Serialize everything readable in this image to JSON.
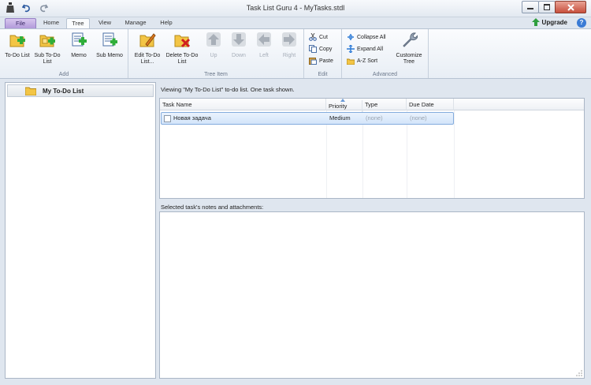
{
  "window": {
    "title": "Task List Guru 4 - MyTasks.stdl"
  },
  "tabs": [
    {
      "label": "File"
    },
    {
      "label": "Home"
    },
    {
      "label": "Tree"
    },
    {
      "label": "View"
    },
    {
      "label": "Manage"
    },
    {
      "label": "Help"
    }
  ],
  "upgrade_label": "Upgrade",
  "ribbon": {
    "add": {
      "label": "Add",
      "buttons": [
        {
          "label": "To-Do List"
        },
        {
          "label": "Sub To-Do List"
        },
        {
          "label": "Memo"
        },
        {
          "label": "Sub Memo"
        }
      ]
    },
    "tree_item": {
      "label": "Tree Item",
      "buttons": [
        {
          "label": "Edit To-Do List..."
        },
        {
          "label": "Delete To-Do List"
        },
        {
          "label": "Up"
        },
        {
          "label": "Down"
        },
        {
          "label": "Left"
        },
        {
          "label": "Right"
        }
      ]
    },
    "edit": {
      "label": "Edit",
      "buttons": [
        {
          "label": "Cut"
        },
        {
          "label": "Copy"
        },
        {
          "label": "Paste"
        }
      ]
    },
    "advanced": {
      "label": "Advanced",
      "buttons": [
        {
          "label": "Collapse All"
        },
        {
          "label": "Expand All"
        },
        {
          "label": "A-Z Sort"
        },
        {
          "label": "Customize Tree"
        }
      ]
    }
  },
  "tree": {
    "items": [
      {
        "label": "My To-Do List"
      }
    ]
  },
  "main": {
    "viewing_text": "Viewing \"My To-Do List\" to-do list. One task shown.",
    "columns": [
      "Task Name",
      "Priority",
      "Type",
      "Due Date"
    ],
    "rows": [
      {
        "name": "Новая задача",
        "priority": "Medium",
        "type": "(none)",
        "due": "(none)"
      }
    ],
    "notes_label": "Selected task's notes and attachments:"
  },
  "colors": {
    "accent": "#3a7bd5",
    "selection": "#d3e5fa",
    "file_tab": "#b19ad9"
  }
}
